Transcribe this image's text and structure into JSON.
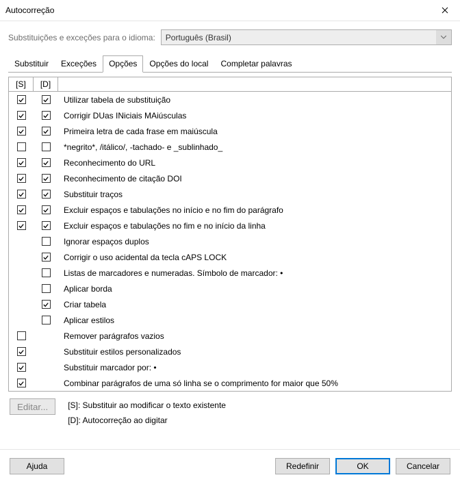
{
  "title": "Autocorreção",
  "lang_label": "Substituições e exceções para o idioma:",
  "lang_value": "Português (Brasil)",
  "tabs": {
    "substituir": "Substituir",
    "excecoes": "Exceções",
    "opcoes": "Opções",
    "opcoes_local": "Opções do local",
    "completar": "Completar palavras"
  },
  "headers": {
    "s": "[S]",
    "d": "[D]"
  },
  "rows": [
    {
      "s": true,
      "d": true,
      "label": "Utilizar tabela de substituição"
    },
    {
      "s": true,
      "d": true,
      "label": "Corrigir DUas INiciais MAiúsculas"
    },
    {
      "s": true,
      "d": true,
      "label": "Primeira letra de cada frase em maiúscula"
    },
    {
      "s": false,
      "d": false,
      "label": "*negrito*, /itálico/, -tachado- e _sublinhado_"
    },
    {
      "s": true,
      "d": true,
      "label": "Reconhecimento do URL"
    },
    {
      "s": true,
      "d": true,
      "label": "Reconhecimento de citação DOI"
    },
    {
      "s": true,
      "d": true,
      "label": "Substituir traços"
    },
    {
      "s": true,
      "d": true,
      "label": "Excluir espaços e tabulações no início e no fim do parágrafo"
    },
    {
      "s": true,
      "d": true,
      "label": "Excluir espaços e tabulações no fim e no início da linha"
    },
    {
      "s": null,
      "d": false,
      "label": "Ignorar espaços duplos"
    },
    {
      "s": null,
      "d": true,
      "label": "Corrigir o uso acidental da tecla cAPS LOCK"
    },
    {
      "s": null,
      "d": false,
      "label": "Listas de marcadores e numeradas. Símbolo de marcador: •"
    },
    {
      "s": null,
      "d": false,
      "label": "Aplicar borda"
    },
    {
      "s": null,
      "d": true,
      "label": "Criar tabela"
    },
    {
      "s": null,
      "d": false,
      "label": "Aplicar estilos"
    },
    {
      "s": false,
      "d": null,
      "label": "Remover parágrafos vazios"
    },
    {
      "s": true,
      "d": null,
      "label": "Substituir estilos personalizados"
    },
    {
      "s": true,
      "d": null,
      "label": "Substituir marcador por: •"
    },
    {
      "s": true,
      "d": null,
      "label": "Combinar parágrafos de uma só linha se o comprimento for maior que 50%"
    }
  ],
  "editar_label": "Editar...",
  "legend_s": "[S]: Substituir ao modificar o texto existente",
  "legend_d": "[D]: Autocorreção ao digitar",
  "buttons": {
    "ajuda": "Ajuda",
    "redefinir": "Redefinir",
    "ok": "OK",
    "cancelar": "Cancelar"
  }
}
